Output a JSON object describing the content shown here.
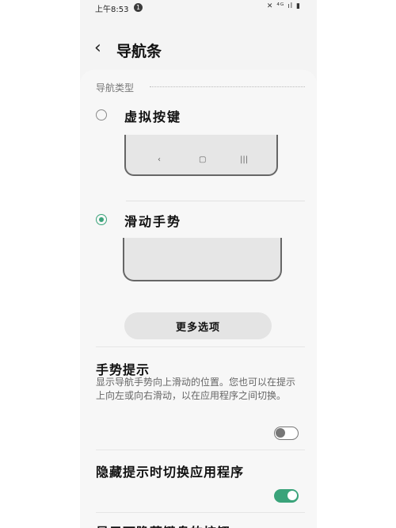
{
  "status": {
    "time": "上午8:53",
    "notif_count": "1",
    "icons": "✕ ⁴ᴳ ıl ▮"
  },
  "appbar": {
    "back_icon": "‹",
    "title": "导航条"
  },
  "nav_type": {
    "label": "导航类型",
    "options": [
      {
        "label": "虚拟按键",
        "selected": false,
        "keys": [
          "‹",
          "▢",
          "|||"
        ]
      },
      {
        "label": "滑动手势",
        "selected": true
      }
    ],
    "more_button": "更多选项"
  },
  "gesture_hint": {
    "title": "手势提示",
    "description": "显示导航手势向上滑动的位置。您也可以在提示上向左或向右滑动，以在应用程序之间切换。",
    "enabled": false
  },
  "hide_hint": {
    "title": "隐藏提示时切换应用程序",
    "enabled": true
  },
  "next_item": {
    "title": "显示可隐藏键盘的按钮"
  },
  "colors": {
    "accent": "#3aa37a"
  }
}
